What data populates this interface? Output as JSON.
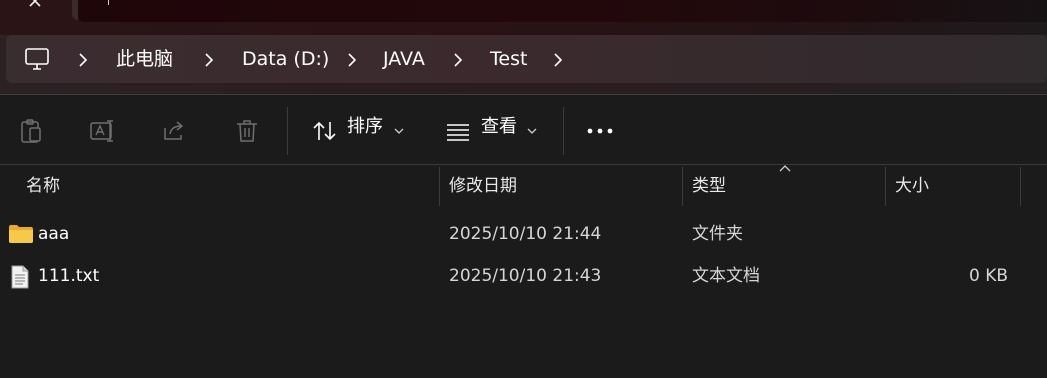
{
  "window": {
    "close_glyph": "×"
  },
  "breadcrumb": {
    "root_icon": "computer-icon",
    "items": [
      {
        "label": "此电脑"
      },
      {
        "label": "Data (D:)"
      },
      {
        "label": "JAVA"
      },
      {
        "label": "Test"
      }
    ]
  },
  "toolbar": {
    "buttons": [
      {
        "name": "copy",
        "icon": "clipboard-icon",
        "enabled": false
      },
      {
        "name": "rename",
        "icon": "rename-icon",
        "enabled": false
      },
      {
        "name": "share",
        "icon": "share-icon",
        "enabled": false
      },
      {
        "name": "delete",
        "icon": "trash-icon",
        "enabled": false
      }
    ],
    "sort_label": "排序",
    "view_label": "查看",
    "more_label": "•••"
  },
  "columns": {
    "name": "名称",
    "modified": "修改日期",
    "type": "类型",
    "size": "大小",
    "sorted_column": "type"
  },
  "files": [
    {
      "name": "aaa",
      "icon": "folder-icon",
      "modified": "2025/10/10 21:44",
      "type": "文件夹",
      "size": ""
    },
    {
      "name": "111.txt",
      "icon": "text-file-icon",
      "modified": "2025/10/10 21:43",
      "type": "文本文档",
      "size": "0 KB"
    }
  ],
  "colors": {
    "background": "#1b1b1b",
    "accent_tab": "#2b1215",
    "folder": "#f0c04a",
    "disabled_icon": "#7a7a7a"
  }
}
